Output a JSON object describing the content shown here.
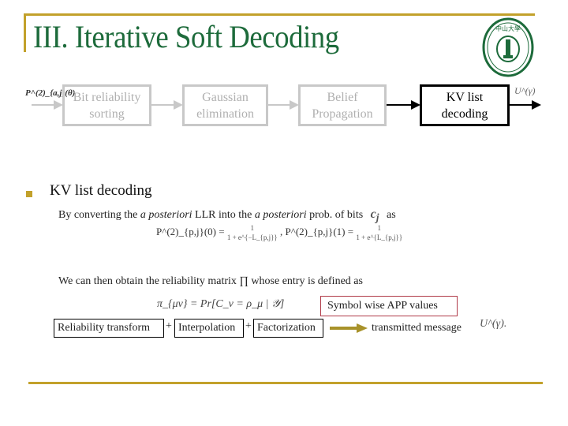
{
  "slide": {
    "title": "III. Iterative Soft Decoding",
    "logo": "sun-yat-sen-university-seal",
    "colors": {
      "frame": "#c2a12b",
      "title": "#1d6b3b",
      "active_box": "#000000",
      "inactive_box": "#c8c8c8",
      "app_box_border": "#b03a48"
    }
  },
  "flow": {
    "input_label": "P^(2)_{a,j}(θ)",
    "output_label": "U^(γ)",
    "blocks": [
      {
        "label_line1": "Bit reliability",
        "label_line2": "sorting",
        "active": false
      },
      {
        "label_line1": "Gaussian",
        "label_line2": "elimination",
        "active": false
      },
      {
        "label_line1": "Belief",
        "label_line2": "Propagation",
        "active": false
      },
      {
        "label_line1": "KV list",
        "label_line2": "decoding",
        "active": true
      }
    ]
  },
  "bullet": {
    "heading": "KV list decoding",
    "line1_a": "By converting the ",
    "line1_b": "a posteriori",
    "line1_c": " LLR into the ",
    "line1_d": "a posteriori",
    "line1_e": " prob. of bits ",
    "line1_var": "c",
    "line1_sub": "j",
    "line1_end": " as",
    "formula1_left": "P^(2)_{p,j}(0) = ",
    "formula1_left_num": "1",
    "formula1_left_den": "1 + e^{−L_{p,j}}",
    "formula1_sep": " , ",
    "formula1_right": "P^(2)_{p,j}(1) = ",
    "formula1_right_num": "1",
    "formula1_right_den": "1 + e^{L_{p,j}}",
    "line2": "We can then obtain the reliability matrix ∏ whose entry is defined as",
    "formula2": "π_{μν} = Pr[C_ν = ρ_μ | 𝒴]",
    "app_label": "Symbol wise APP values",
    "steps": [
      "Reliability transform",
      "Interpolation",
      "Factorization"
    ],
    "plus": "+",
    "result_text": "transmitted message",
    "result_var": "U^(γ)."
  }
}
